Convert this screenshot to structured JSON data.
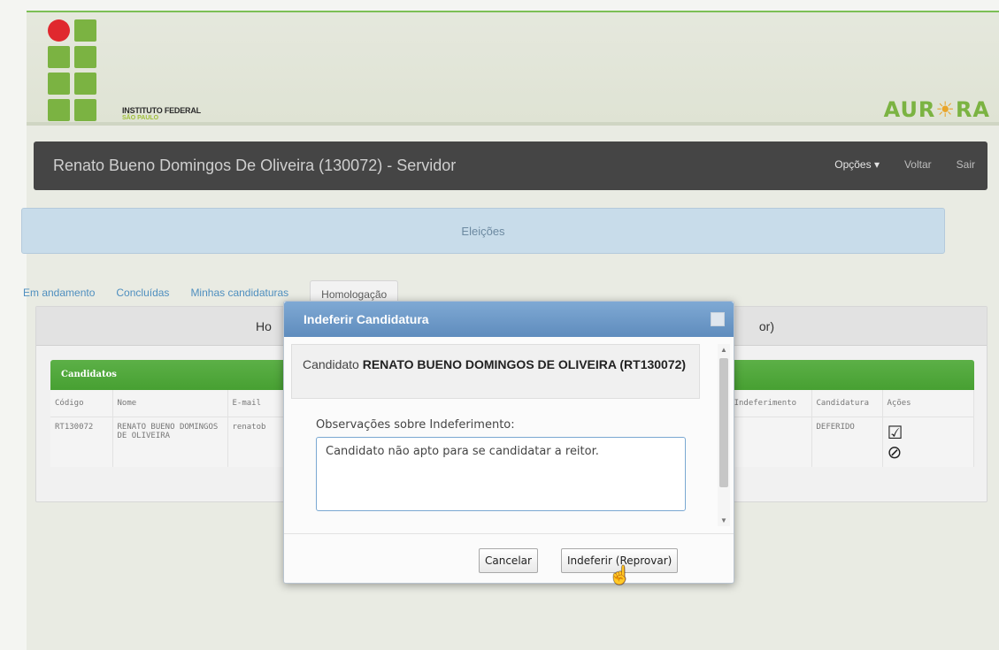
{
  "header": {
    "institute_line1": "INSTITUTO FEDERAL",
    "institute_line2": "SÃO PAULO",
    "brand_left": "AUR",
    "brand_sun": "☀",
    "brand_right": "RA"
  },
  "navbar": {
    "user_title": "Renato Bueno Domingos De Oliveira (130072) - Servidor",
    "opcoes": "Opções ▾",
    "voltar": "Voltar",
    "sair": "Sair"
  },
  "section_title": "Eleições",
  "tabs": [
    {
      "label": "Em andamento"
    },
    {
      "label": "Concluídas"
    },
    {
      "label": "Minhas candidaturas"
    },
    {
      "label": "Homologação"
    }
  ],
  "panel": {
    "title_left": "Ho",
    "title_right": "or)"
  },
  "candidates": {
    "header": "Candidatos",
    "columns": [
      "Código",
      "Nome",
      "E-mail",
      "Obs. Indeferimento",
      "Candidatura",
      "Ações"
    ],
    "row": {
      "codigo": "RT130072",
      "nome": "RENATO BUENO DOMINGOS DE OLIVEIRA",
      "email": "renatob",
      "obs": "",
      "candidatura": "DEFERIDO",
      "approve_icon": "☑",
      "reject_icon": "⊘"
    }
  },
  "modal": {
    "title": "Indeferir Candidatura",
    "candidate_prefix": "Candidato ",
    "candidate_name": "RENATO BUENO DOMINGOS DE OLIVEIRA (RT130072)",
    "obs_label": "Observações sobre Indeferimento:",
    "obs_value": "Candidato não apto para se candidatar a reitor.",
    "cancel_label": "Cancelar",
    "reject_label": "Indeferir (Reprovar)"
  },
  "colors": {
    "accent_green": "#5cb047",
    "navbar": "#454545",
    "modal_header": "#6f9bc9"
  }
}
